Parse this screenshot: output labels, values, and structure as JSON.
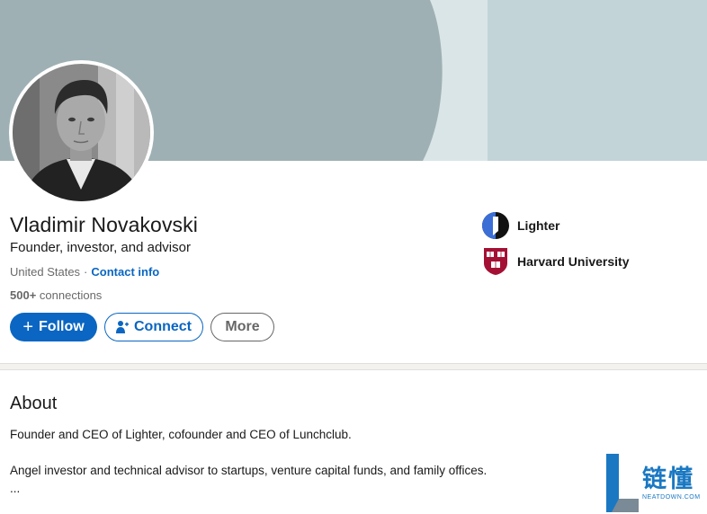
{
  "profile": {
    "name": "Vladimir Novakovski",
    "headline": "Founder, investor, and advisor",
    "location": "United States",
    "separator": "·",
    "contact_info": "Contact info",
    "connections_count": "500+",
    "connections_label": "connections"
  },
  "actions": {
    "follow": "Follow",
    "connect": "Connect",
    "more": "More"
  },
  "orgs": [
    {
      "name": "Lighter",
      "icon": "lighter-logo"
    },
    {
      "name": "Harvard University",
      "icon": "harvard-shield-logo"
    }
  ],
  "about": {
    "title": "About",
    "p1": "Founder and CEO of Lighter, cofounder and CEO of Lunchclub.",
    "p2": "Angel investor and technical advisor to startups, venture capital funds, and family offices.",
    "ellipsis": "..."
  },
  "watermark": {
    "chars": "链懂",
    "sub": "NEATDOWN.COM"
  },
  "colors": {
    "brand": "#0a66c2",
    "cover_dark": "#9fb0b4",
    "cover_light": "#c2d4d8",
    "divider": "#f3f2ef"
  }
}
